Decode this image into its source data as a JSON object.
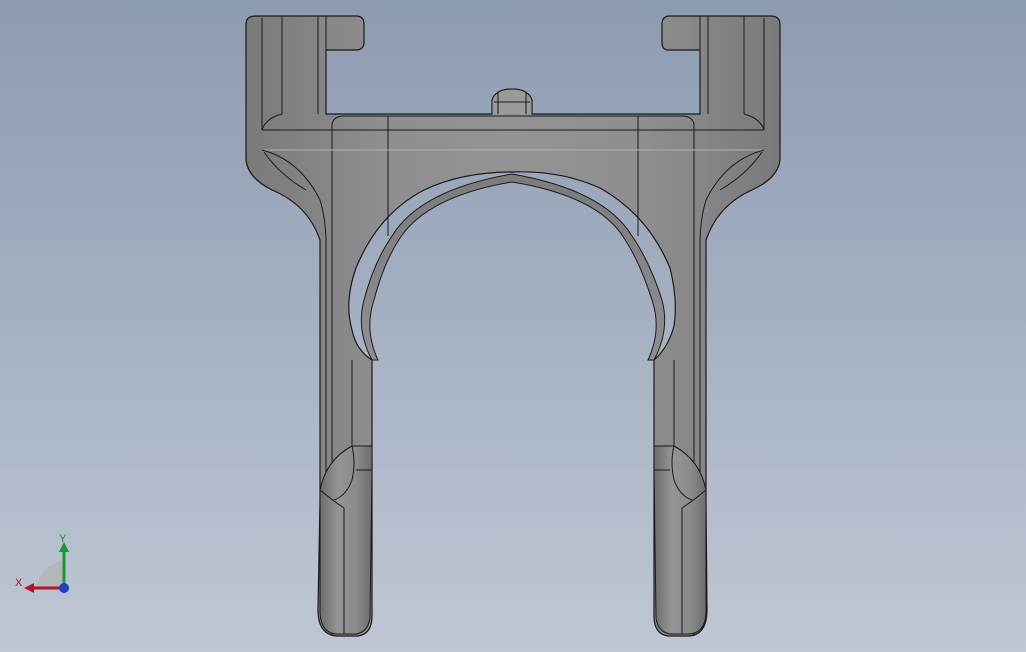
{
  "viewport": {
    "background_top": "#8d9bb1",
    "background_bottom": "#bfc7d3"
  },
  "model": {
    "part_color": "#8c8c8c",
    "edge_color": "#1a1a1a"
  },
  "triad": {
    "x_label": "X",
    "y_label": "Y",
    "x_color": "#b0162a",
    "y_color": "#129a2c",
    "z_color": "#1f3fbf"
  }
}
